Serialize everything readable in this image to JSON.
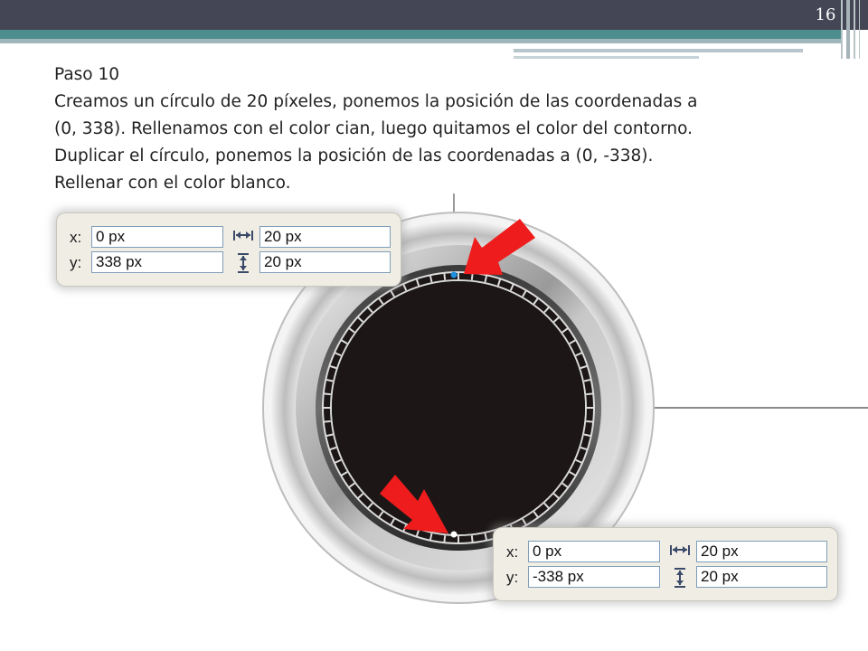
{
  "slide": {
    "page_number": "16",
    "heading": "Paso 10",
    "lines": [
      "Creamos un círculo de 20 píxeles, ponemos  la posición de las coordenadas a",
      "(0, 338). Rellenamos con el color cian, luego quitamos el color del contorno.",
      "Duplicar el círculo, ponemos  la posición de las coordenadas a  (0, -338).",
      "Rellenar con el color blanco."
    ]
  },
  "panel_top": {
    "x_label": "x:",
    "x_value": "0 px",
    "y_label": "y:",
    "y_value": "338 px",
    "width_value": "20 px",
    "height_value": "20 px",
    "width_icon": "width-arrows-icon",
    "height_icon": "height-arrows-icon"
  },
  "panel_bottom": {
    "x_label": "x:",
    "x_value": "0 px",
    "y_label": "y:",
    "y_value": "-338 px",
    "width_value": "20 px",
    "height_value": "20 px",
    "width_icon": "width-arrows-icon",
    "height_icon": "height-arrows-icon"
  },
  "colors": {
    "header_dark": "#444655",
    "header_teal": "#4c8e8e",
    "watch_face": "#1c1716",
    "cyan_dot": "#1e90e0",
    "white_dot": "#ffffff",
    "arrow": "#ee1c1c"
  },
  "icons": [
    "arrow-pointer-top-icon",
    "arrow-pointer-bottom-icon"
  ]
}
